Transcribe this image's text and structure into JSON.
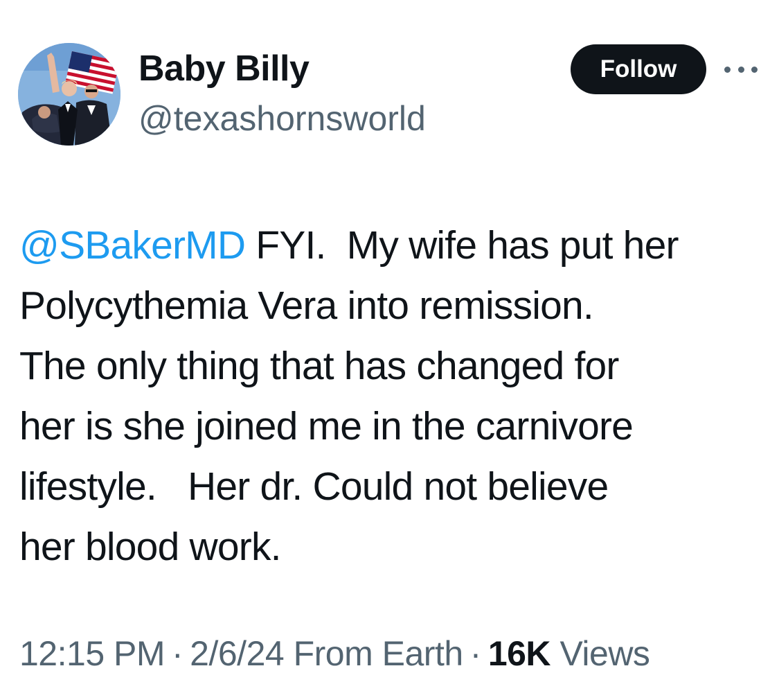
{
  "author": {
    "display_name": "Baby Billy",
    "handle": "@texashornsworld",
    "avatar_icon": "profile-photo"
  },
  "actions": {
    "follow_label": "Follow",
    "more_icon": "ellipsis-icon"
  },
  "tweet": {
    "mention": "@SBakerMD",
    "text": " FYI.  My wife has put her\nPolycythemia Vera into remission.\nThe only thing that has changed for\nher is she joined me in the carnivore\nlifestyle.   Her dr. Could not believe\nher blood work."
  },
  "meta": {
    "time": "12:15 PM",
    "separator": "·",
    "date": "2/6/24",
    "source": "From Earth",
    "views_count": "16K",
    "views_label": "Views"
  },
  "colors": {
    "text": "#0f1419",
    "secondary": "#536471",
    "link": "#1d9bf0",
    "follow_bg": "#0f1419"
  }
}
